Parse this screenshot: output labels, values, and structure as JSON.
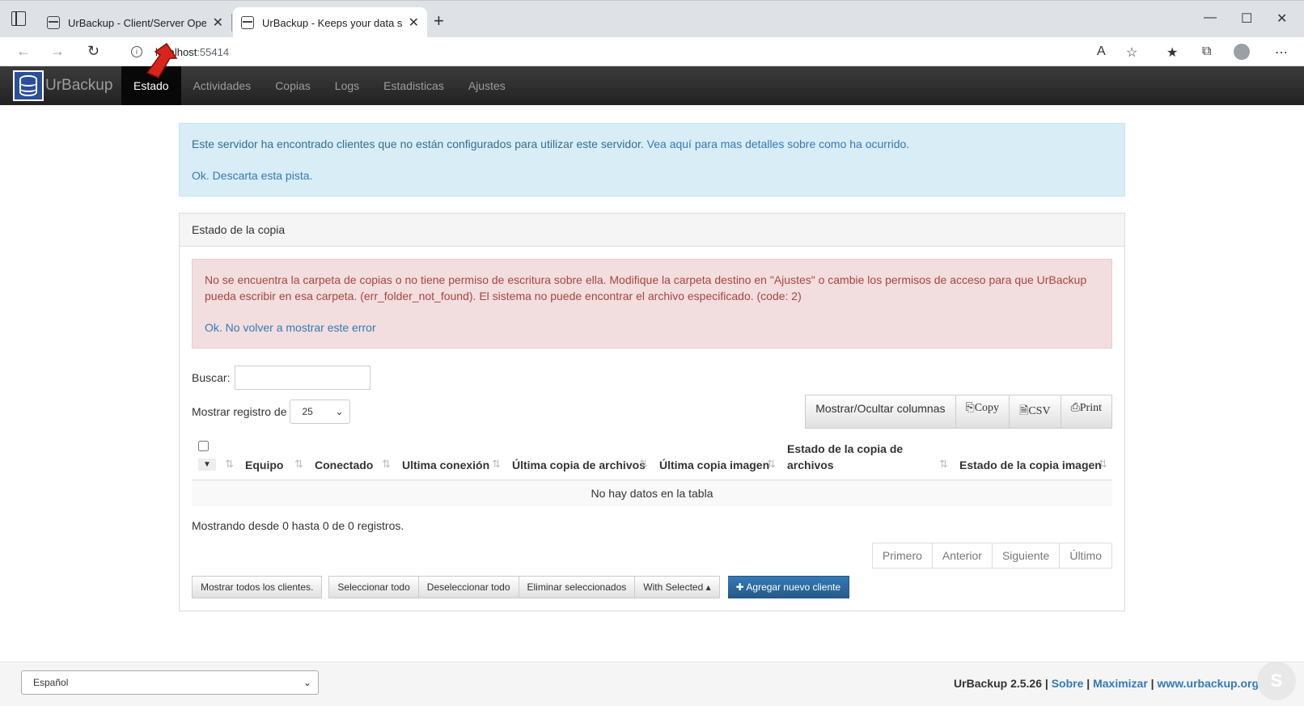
{
  "browser": {
    "tabs": [
      {
        "title": "UrBackup - Client/Server Open S",
        "active": false
      },
      {
        "title": "UrBackup - Keeps your data safe",
        "active": true
      }
    ],
    "url_host": "localhost",
    "url_port": ":55414"
  },
  "app": {
    "brand": "UrBackup",
    "nav": [
      "Estado",
      "Actividades",
      "Copias",
      "Logs",
      "Estadisticas",
      "Ajustes"
    ],
    "info_alert": {
      "text": "Este servidor ha encontrado clientes que no están configurados para utilizar este servidor.",
      "link": "Vea aquí para mas detalles sobre como ha ocurrido.",
      "dismiss": "Ok. Descarta esta pista."
    },
    "panel_title": "Estado de la copia",
    "error_alert": {
      "text": "No se encuentra la carpeta de copias o no tiene permiso de escritura sobre ella. Modifique la carpeta destino en \"Ajustes\" o cambie los permisos de acceso para que UrBackup pueda escribir en esa carpeta. (err_folder_not_found). El sistema no puede encontrar el archivo especificado. (code: 2)",
      "dismiss": "Ok. No volver a mostrar este error"
    },
    "search_label": "Buscar:",
    "length_label": "Mostrar registro de",
    "length_value": "25",
    "table_buttons": [
      "Mostrar/Ocultar columnas",
      "Copy",
      "CSV",
      "Print"
    ],
    "columns": [
      "Equipo",
      "Conectado",
      "Ultima conexión",
      "Última copia de archivos",
      "Última copia imagen",
      "Estado de la copia de archivos",
      "Estado de la copia imagen"
    ],
    "empty_text": "No hay datos en la tabla",
    "info_text": "Mostrando desde 0 hasta 0 de 0 registros.",
    "pager": [
      "Primero",
      "Anterior",
      "Siguiente",
      "Último"
    ],
    "actions": [
      "Mostrar todos los clientes.",
      "Seleccionar todo",
      "Deseleccionar todo",
      "Eliminar seleccionados",
      "With Selected"
    ],
    "add_button": "Agregar nuevo cliente",
    "footer": {
      "language": "Español",
      "version": "UrBackup 2.5.26",
      "links": [
        "Sobre",
        "Maximizar",
        "www.urbackup.org"
      ]
    }
  }
}
